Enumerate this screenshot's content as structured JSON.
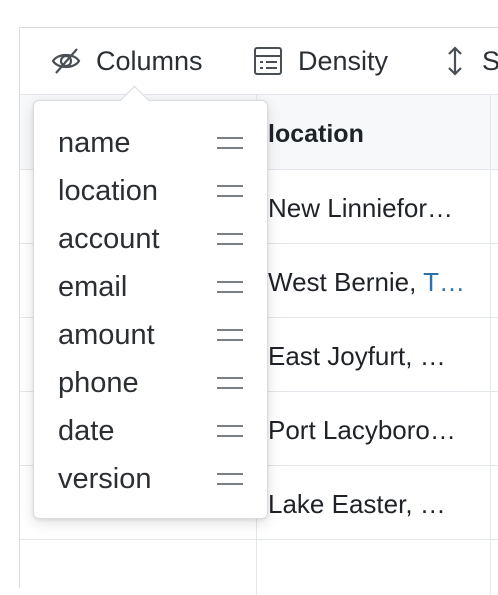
{
  "toolbar": {
    "columns_label": "Columns",
    "density_label": "Density",
    "sort_partial_label": "S"
  },
  "grid": {
    "header": {
      "location": "location"
    },
    "rows": [
      {
        "location": "New Linniefor…"
      },
      {
        "location_prefix": "West Bernie, ",
        "location_link": "T…"
      },
      {
        "location": "East Joyfurt, …"
      },
      {
        "location": "Port Lacyboro…"
      },
      {
        "location": "Lake Easter, …"
      }
    ]
  },
  "columns_menu": {
    "items": [
      {
        "label": "name"
      },
      {
        "label": "location"
      },
      {
        "label": "account"
      },
      {
        "label": "email"
      },
      {
        "label": "amount"
      },
      {
        "label": "phone"
      },
      {
        "label": "date"
      },
      {
        "label": "version"
      }
    ]
  },
  "icons": {
    "columns": "eye-slash-icon",
    "density": "density-list-icon",
    "sort": "sort-arrows-icon",
    "drag": "drag-handle-icon"
  },
  "colors": {
    "link": "#2f6fa7",
    "border": "#e3e6ea",
    "header_bg": "#f7f8fa"
  }
}
